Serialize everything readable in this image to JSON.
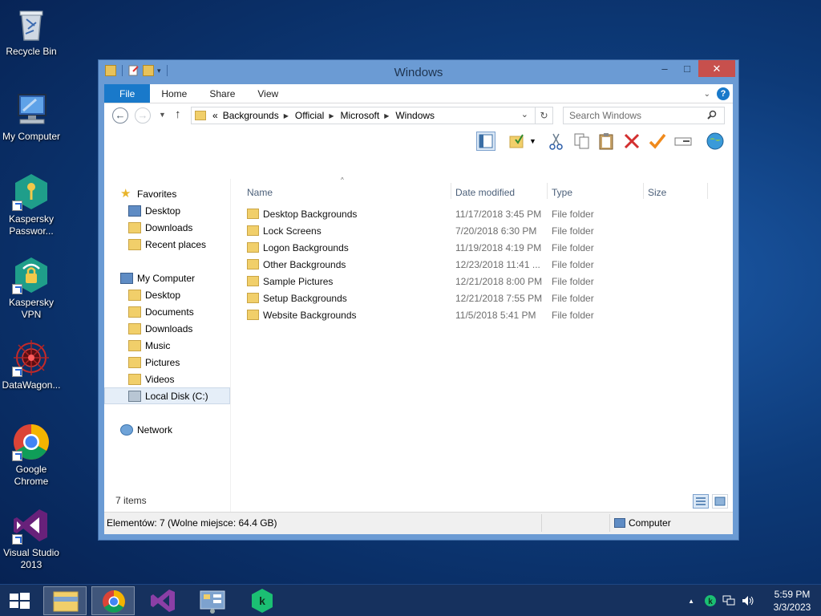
{
  "desktop": {
    "icons": [
      {
        "label": "Recycle Bin"
      },
      {
        "label": "My Computer"
      },
      {
        "label": "Kaspersky Passwor..."
      },
      {
        "label": "Kaspersky VPN"
      },
      {
        "label": "DataWagon..."
      },
      {
        "label": "Google Chrome"
      },
      {
        "label": "Visual Studio 2013"
      }
    ]
  },
  "window": {
    "title": "Windows",
    "controls": {
      "minimize": "–",
      "maximize": "□",
      "close": "✕"
    },
    "ribbon_tabs": [
      "File",
      "Home",
      "Share",
      "View"
    ],
    "help": "?",
    "address": {
      "prefix": "«",
      "segments": [
        "Backgrounds",
        "Official",
        "Microsoft",
        "Windows"
      ]
    },
    "search_placeholder": "Search Windows",
    "nav": {
      "favorites_label": "Favorites",
      "favorites": [
        "Desktop",
        "Downloads",
        "Recent places"
      ],
      "computer_label": "My Computer",
      "computer": [
        "Desktop",
        "Documents",
        "Downloads",
        "Music",
        "Pictures",
        "Videos",
        "Local Disk (C:)"
      ],
      "network_label": "Network"
    },
    "columns": [
      "Name",
      "Date modified",
      "Type",
      "Size"
    ],
    "files": [
      {
        "name": "Desktop Backgrounds",
        "date": "11/17/2018 3:45 PM",
        "type": "File folder"
      },
      {
        "name": "Lock Screens",
        "date": "7/20/2018 6:30 PM",
        "type": "File folder"
      },
      {
        "name": "Logon Backgrounds",
        "date": "11/19/2018 4:19 PM",
        "type": "File folder"
      },
      {
        "name": "Other Backgrounds",
        "date": "12/23/2018 11:41 ...",
        "type": "File folder"
      },
      {
        "name": "Sample Pictures",
        "date": "12/21/2018 8:00 PM",
        "type": "File folder"
      },
      {
        "name": "Setup Backgrounds",
        "date": "12/21/2018 7:55 PM",
        "type": "File folder"
      },
      {
        "name": "Website Backgrounds",
        "date": "11/5/2018 5:41 PM",
        "type": "File folder"
      }
    ],
    "item_count": "7 items",
    "status_left": "Elementów: 7 (Wolne miejsce: 64.4 GB)",
    "status_right": "Computer"
  },
  "taskbar": {
    "time": "5:59 PM",
    "date": "3/3/2023",
    "tray_arrow": "▲"
  },
  "colors": {
    "ribbon_file": "#1979ca",
    "window_frame": "#6b9bd4",
    "close_button": "#c7504d",
    "taskbar": "#16315e"
  }
}
